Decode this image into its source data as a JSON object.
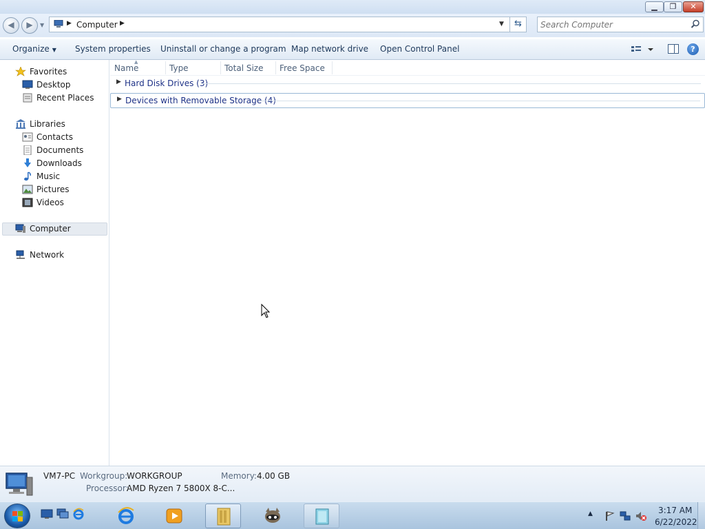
{
  "window": {
    "caption_buttons": {
      "minimize": "▁",
      "maximize": "❐",
      "close": "✕"
    }
  },
  "address_bar": {
    "back_glyph": "◀",
    "forward_glyph": "▶",
    "breadcrumb": [
      "Computer"
    ],
    "path_text": "Computer",
    "search_placeholder": "Search Computer"
  },
  "command_bar": {
    "organize": "Organize",
    "system_properties": "System properties",
    "uninstall": "Uninstall or change a program",
    "map_network_drive": "Map network drive",
    "open_control_panel": "Open Control Panel",
    "help": "?"
  },
  "nav_pane": {
    "favorites": "Favorites",
    "favorites_items": [
      "Desktop",
      "Recent Places"
    ],
    "libraries": "Libraries",
    "libraries_items": [
      "Contacts",
      "Documents",
      "Downloads",
      "Music",
      "Pictures",
      "Videos"
    ],
    "computer": "Computer",
    "network": "Network"
  },
  "content": {
    "columns": [
      "Name",
      "Type",
      "Total Size",
      "Free Space"
    ],
    "groups": [
      {
        "label": "Hard Disk Drives (3)"
      },
      {
        "label": "Devices with Removable Storage (4)"
      }
    ]
  },
  "details_pane": {
    "computer_name": "VM7-PC",
    "workgroup_label": "Workgroup:",
    "workgroup_value": "WORKGROUP",
    "memory_label": "Memory:",
    "memory_value": "4.00 GB",
    "processor_label": "Processor:",
    "processor_value": "AMD Ryzen 7 5800X 8-C..."
  },
  "taskbar": {
    "clock_time": "3:17 AM",
    "clock_date": "6/22/2022"
  },
  "colors": {
    "accent": "#1e3287",
    "command_text": "#1e395b",
    "taskbar": "#a9c4de"
  }
}
